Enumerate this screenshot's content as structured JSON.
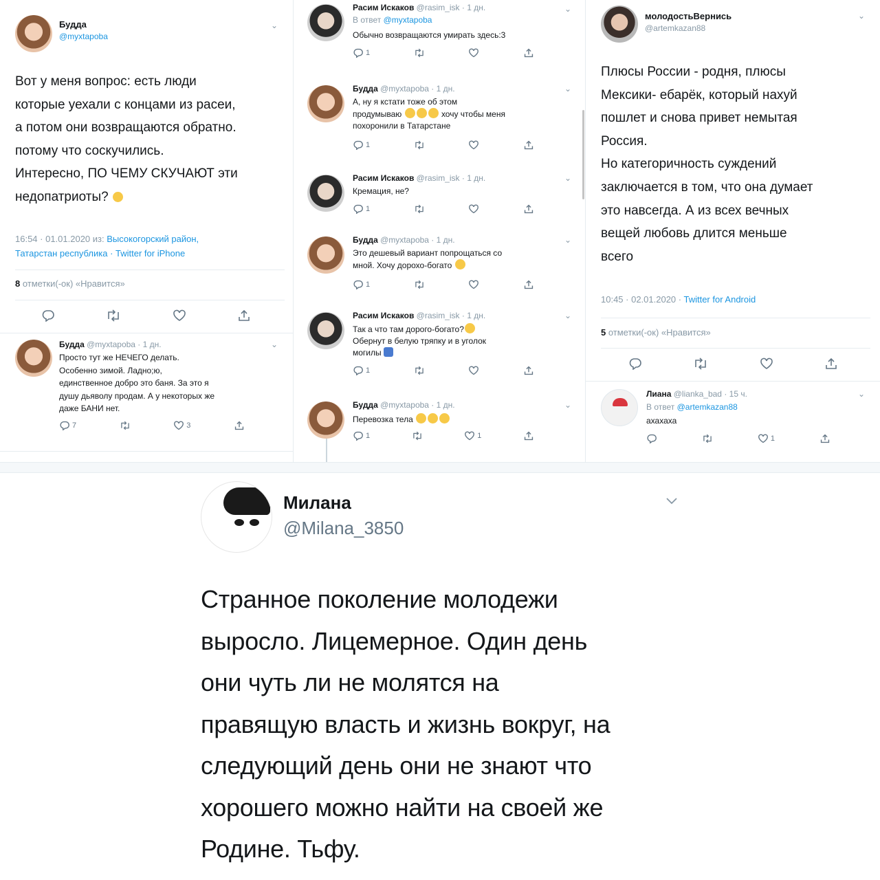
{
  "colors": {
    "link": "#1b95e0",
    "muted": "#8899a6",
    "text": "#14171a",
    "divider": "#e6ecf0"
  },
  "left": {
    "main": {
      "name": "Будда",
      "handle": "@myxtapoba",
      "text_lines": [
        "Вот у меня вопрос: есть люди",
        "которые уехали с концами из расеи,",
        "а потом они возвращаются обратно.",
        "потому что соскучились.",
        "Интересно, ПО ЧЕМУ СКУЧАЮТ эти",
        "недопатриоты?"
      ],
      "time_prefix": "16:54 · 01.01.2020 из: ",
      "location_line1": "Высокогорский район,",
      "location_line2": "Татарстан республика",
      "client": " · Twitter for iPhone",
      "likes_count": "8",
      "likes_label": " отметки(-ок) «Нравится»"
    },
    "reply": {
      "name": "Будда",
      "meta": "@myxtapoba · 1 дн.",
      "text_lines": [
        "Просто тут же НЕЧЕГО делать.",
        "Особенно зимой. Ладно;ю,",
        "единственное добро это баня. За это я",
        "душу дьяволу продам. А у некоторых же",
        "даже БАНИ нет."
      ],
      "reply_count": "7",
      "like_count": "3"
    }
  },
  "mid": {
    "t1": {
      "name": "Расим Искаков",
      "meta": "@rasim_isk · 1 дн.",
      "reply_to_prefix": "В ответ ",
      "reply_to": "@myxtapoba",
      "text": "Обычно возвращаются умирать здесь:3",
      "reply_count": "1"
    },
    "t2": {
      "name": "Будда",
      "meta": "@myxtapoba · 1 дн.",
      "line1": "А, ну я кстати тоже об этом",
      "line2a": "продумываю",
      "line2b": "хочу чтобы меня",
      "line3": "похоронили в Татарстане",
      "reply_count": "1"
    },
    "t3": {
      "name": "Расим Искаков",
      "meta": "@rasim_isk · 1 дн.",
      "text": "Кремация, не?",
      "reply_count": "1"
    },
    "t4": {
      "name": "Будда",
      "meta": "@myxtapoba · 1 дн.",
      "line1": "Это дешевый вариант попрощаться со",
      "line2": "мной. Хочу дорохо-богато",
      "reply_count": "1"
    },
    "t5": {
      "name": "Расим Искаков",
      "meta": "@rasim_isk · 1 дн.",
      "line1": "Так а что там дорого-богато?",
      "line2": "Обернут в белую тряпку и в уголок",
      "line3": "могилы",
      "reply_count": "1"
    },
    "t6": {
      "name": "Будда",
      "meta": "@myxtapoba · 1 дн.",
      "text": "Перевозка тела",
      "reply_count": "1",
      "like_count": "1"
    }
  },
  "right": {
    "main": {
      "name": "молодостьВернись",
      "handle": "@artemkazan88",
      "text_lines": [
        "Плюсы России - родня, плюсы",
        "Мексики- ебарёк, который нахуй",
        "пошлет и снова привет немытая",
        "Россия.",
        "Но категоричность суждений",
        "заключается в том, что она думает",
        "это навсегда.  А из всех вечных",
        "вещей любовь длится меньше",
        "всего"
      ],
      "time": "10:45 · 02.01.2020 · ",
      "client": "Twitter for Android",
      "likes_count": "5",
      "likes_label": " отметки(-ок) «Нравится»"
    },
    "reply": {
      "name": "Лиана",
      "meta": "@lianka_bad · 15 ч.",
      "reply_to_prefix": "В ответ ",
      "reply_to": "@artemkazan88",
      "text": "ахахаха",
      "like_count": "1"
    }
  },
  "milana": {
    "name": "Милана",
    "handle": "@Milana_3850",
    "text_lines": [
      "Странное поколение молодежи",
      "выросло. Лицемерное. Один день",
      "они чуть ли не молятся на",
      "правящую власть и жизнь вокруг, на",
      "следующий день они не знают что",
      "хорошего можно найти на своей же",
      "Родине. Тьфу."
    ]
  }
}
